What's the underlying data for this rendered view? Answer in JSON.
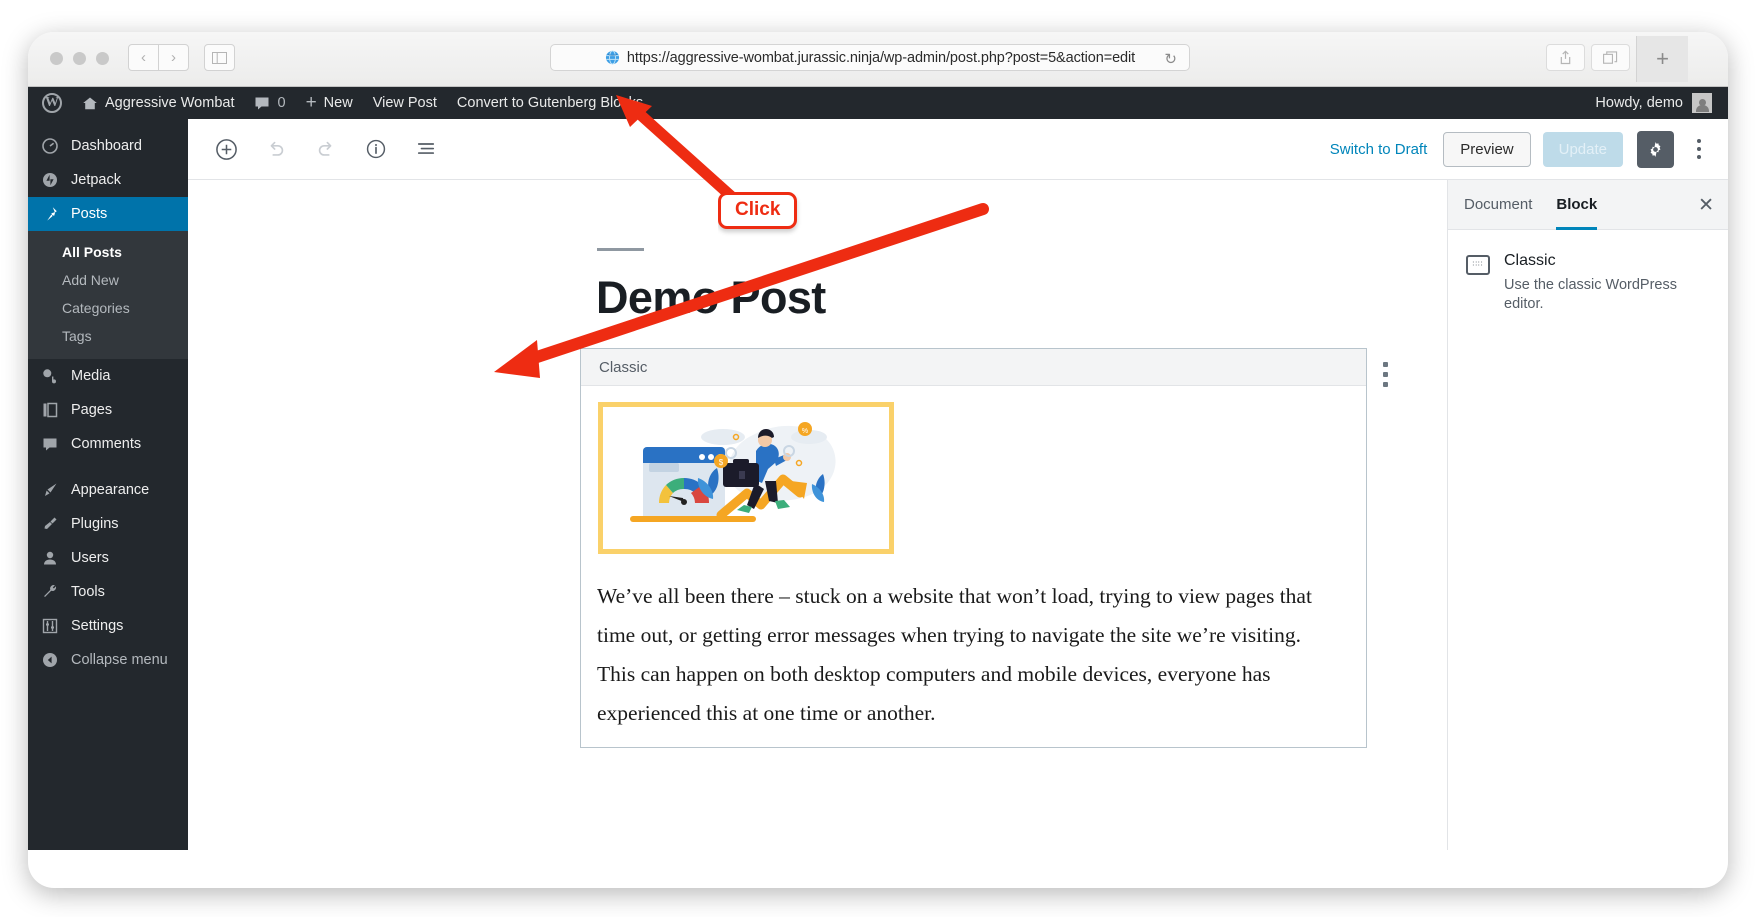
{
  "browser": {
    "url": "https://aggressive-wombat.jurassic.ninja/wp-admin/post.php?post=5&action=edit",
    "back_icon": "‹",
    "forward_icon": "›",
    "sidebar_icon": "▤",
    "reload_icon": "↻",
    "share_icon": "↑",
    "tabs_icon": "⧉",
    "newtab_icon": "+"
  },
  "adminbar": {
    "logo": "W",
    "site_name": "Aggressive Wombat",
    "home_icon": "⌂",
    "comment_icon": "💬",
    "comment_count": "0",
    "new_plus": "+",
    "new_label": "New",
    "view_post": "View Post",
    "convert": "Convert to Gutenberg Blocks",
    "howdy": "Howdy, demo"
  },
  "sidebar": {
    "items": [
      {
        "label": "Dashboard",
        "icon": "◔"
      },
      {
        "label": "Jetpack",
        "icon": "◑"
      },
      {
        "label": "Posts",
        "icon": "📌"
      },
      {
        "label": "Media",
        "icon": "♪"
      },
      {
        "label": "Pages",
        "icon": "▤"
      },
      {
        "label": "Comments",
        "icon": "💬"
      },
      {
        "label": "Appearance",
        "icon": "✎"
      },
      {
        "label": "Plugins",
        "icon": "⌁"
      },
      {
        "label": "Users",
        "icon": "👤"
      },
      {
        "label": "Tools",
        "icon": "🔧"
      },
      {
        "label": "Settings",
        "icon": "⚙"
      },
      {
        "label": "Collapse menu",
        "icon": "◀"
      }
    ],
    "submenu": [
      {
        "label": "All Posts"
      },
      {
        "label": "Add New"
      },
      {
        "label": "Categories"
      },
      {
        "label": "Tags"
      }
    ]
  },
  "toolbar": {
    "add_icon": "⊕",
    "undo_icon": "↶",
    "redo_icon": "↷",
    "info_icon": "ⓘ",
    "list_icon": "☰",
    "switch_to_draft": "Switch to Draft",
    "preview": "Preview",
    "update": "Update",
    "gear_icon": "⚙"
  },
  "post": {
    "title": "Demo Post",
    "block_label": "Classic",
    "body": "We’ve all been there – stuck on a website that won’t load, trying to view pages that time out, or getting error messages when trying to navigate the site we’re visiting. This can happen on both desktop computers and mobile devices, everyone has experienced this at one time or another."
  },
  "settings_panel": {
    "tab_document": "Document",
    "tab_block": "Block",
    "close_icon": "✕",
    "block_name": "Classic",
    "block_description": "Use the classic WordPress editor.",
    "keyboard_glyph": "∷∷"
  },
  "annotation": {
    "click_label": "Click",
    "arrow_color": "#ee2c12"
  }
}
